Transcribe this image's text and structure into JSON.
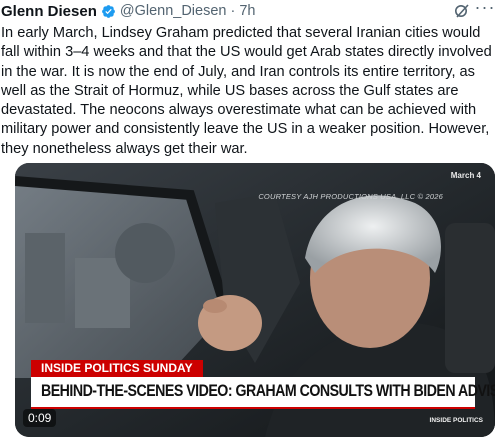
{
  "tweet": {
    "author_name": "Glenn Diesen",
    "handle": "@Glenn_Diesen",
    "separator": "·",
    "age": "7h",
    "text": "In early March, Lindsey Graham predicted that several Iranian cities would fall within 3–4 weeks and that the US would get Arab states directly involved in the war. It is now the end of July, and Iran controls its entire territory, as well as the Strait of Hormuz, while US bases across the Gulf states are devastated. The neocons always overestimate what can be achieved with military power and consistently leave the US in a weaker position. However, they nonetheless always get their war."
  },
  "video": {
    "date_badge": "March 4",
    "courtesy": "COURTESY AJH PRODUCTIONS USA, LLC © 2026",
    "show_tag": "INSIDE POLITICS SUNDAY",
    "chyron": "BEHIND-THE-SCENES VIDEO: GRAHAM CONSULTS WITH BIDEN ADVISER",
    "timestamp": "0:09",
    "watermark": "INSIDE POLITICS"
  },
  "icons": {
    "verified": "verified-badge-icon",
    "grok": "grok-icon",
    "more": "more-options-icon"
  },
  "colors": {
    "verified_blue": "#1d9bf0",
    "muted_text": "#536471",
    "cnn_red": "#cc0000"
  }
}
